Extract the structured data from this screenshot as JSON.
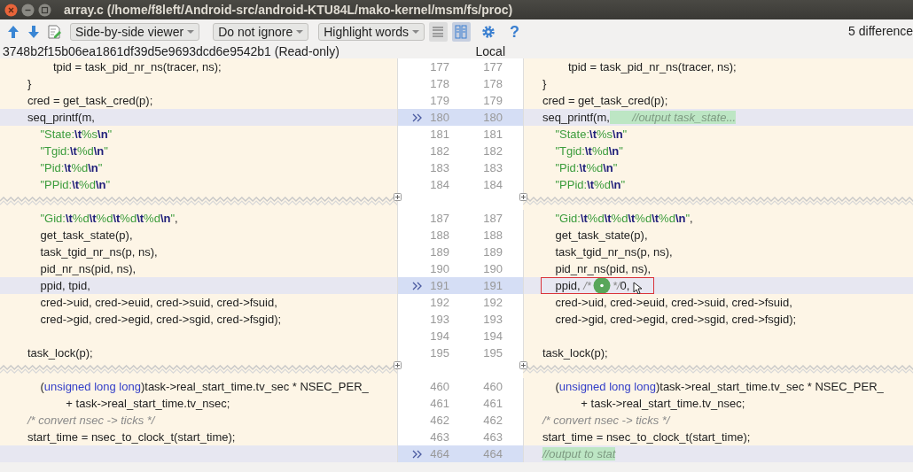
{
  "window": {
    "title": "array.c (/home/f8left/Android-src/android-KTU84L/mako-kernel/msm/fs/proc)"
  },
  "toolbar": {
    "viewer": "Side-by-side viewer",
    "ignore": "Do not ignore",
    "highlight": "Highlight words",
    "toggles": [
      {
        "selected": false
      },
      {
        "selected": true
      }
    ],
    "help": "?",
    "differences": "5 difference"
  },
  "header": {
    "left": "3748b2f15b06ea1861df39d5e9693dcd6e9542b1 (Read-only)",
    "right": "Local"
  },
  "hunks": [
    {
      "rows": [
        {
          "left_number": "177",
          "right_number": "177",
          "changed": false,
          "left": [
            {
              "text": "        tpid = task_pid_nr_ns(tracer, ns);",
              "kind": "code"
            }
          ],
          "right": [
            {
              "text": "        tpid = task_pid_nr_ns(tracer, ns);",
              "kind": "code"
            }
          ]
        },
        {
          "left_number": "178",
          "right_number": "178",
          "changed": false,
          "left": [
            {
              "text": "}",
              "kind": "code"
            }
          ],
          "right": [
            {
              "text": "}",
              "kind": "code"
            }
          ]
        },
        {
          "left_number": "179",
          "right_number": "179",
          "changed": false,
          "left": [
            {
              "text": "cred = get_task_cred(p);",
              "kind": "code"
            }
          ],
          "right": [
            {
              "text": "cred = get_task_cred(p);",
              "kind": "code"
            }
          ]
        },
        {
          "left_number": "180",
          "right_number": "180",
          "changed": true,
          "left": [
            {
              "text": "seq_printf(m,",
              "kind": "code"
            }
          ],
          "right": [
            {
              "text": "seq_printf(m,",
              "kind": "code"
            },
            {
              "text": "       //output task_state...",
              "kind": "added"
            }
          ]
        },
        {
          "left_number": "181",
          "right_number": "181",
          "changed": false,
          "left": [
            {
              "text": "    \"State:",
              "kind": "string"
            },
            {
              "text": "\\t",
              "kind": "escape"
            },
            {
              "text": "%s",
              "kind": "string"
            },
            {
              "text": "\\n",
              "kind": "escape"
            },
            {
              "text": "\"",
              "kind": "string"
            }
          ],
          "right": [
            {
              "text": "    \"State:",
              "kind": "string"
            },
            {
              "text": "\\t",
              "kind": "escape"
            },
            {
              "text": "%s",
              "kind": "string"
            },
            {
              "text": "\\n",
              "kind": "escape"
            },
            {
              "text": "\"",
              "kind": "string"
            }
          ]
        },
        {
          "left_number": "182",
          "right_number": "182",
          "changed": false,
          "left": [
            {
              "text": "    \"Tgid:",
              "kind": "string"
            },
            {
              "text": "\\t",
              "kind": "escape"
            },
            {
              "text": "%d",
              "kind": "string"
            },
            {
              "text": "\\n",
              "kind": "escape"
            },
            {
              "text": "\"",
              "kind": "string"
            }
          ],
          "right": [
            {
              "text": "    \"Tgid:",
              "kind": "string"
            },
            {
              "text": "\\t",
              "kind": "escape"
            },
            {
              "text": "%d",
              "kind": "string"
            },
            {
              "text": "\\n",
              "kind": "escape"
            },
            {
              "text": "\"",
              "kind": "string"
            }
          ]
        },
        {
          "left_number": "183",
          "right_number": "183",
          "changed": false,
          "left": [
            {
              "text": "    \"Pid:",
              "kind": "string"
            },
            {
              "text": "\\t",
              "kind": "escape"
            },
            {
              "text": "%d",
              "kind": "string"
            },
            {
              "text": "\\n",
              "kind": "escape"
            },
            {
              "text": "\"",
              "kind": "string"
            }
          ],
          "right": [
            {
              "text": "    \"Pid:",
              "kind": "string"
            },
            {
              "text": "\\t",
              "kind": "escape"
            },
            {
              "text": "%d",
              "kind": "string"
            },
            {
              "text": "\\n",
              "kind": "escape"
            },
            {
              "text": "\"",
              "kind": "string"
            }
          ]
        },
        {
          "left_number": "184",
          "right_number": "184",
          "changed": false,
          "left": [
            {
              "text": "    \"PPid:",
              "kind": "string"
            },
            {
              "text": "\\t",
              "kind": "escape"
            },
            {
              "text": "%d",
              "kind": "string"
            },
            {
              "text": "\\n",
              "kind": "escape"
            },
            {
              "text": "\"",
              "kind": "string"
            }
          ],
          "right": [
            {
              "text": "    \"PPid:",
              "kind": "string"
            },
            {
              "text": "\\t",
              "kind": "escape"
            },
            {
              "text": "%d",
              "kind": "string"
            },
            {
              "text": "\\n",
              "kind": "escape"
            },
            {
              "text": "\"",
              "kind": "string"
            }
          ]
        }
      ]
    },
    {
      "rows": [
        {
          "left_number": "187",
          "right_number": "187",
          "changed": false,
          "left": [
            {
              "text": "    \"Gid:",
              "kind": "string"
            },
            {
              "text": "\\t",
              "kind": "escape"
            },
            {
              "text": "%d",
              "kind": "string"
            },
            {
              "text": "\\t",
              "kind": "escape"
            },
            {
              "text": "%d",
              "kind": "string"
            },
            {
              "text": "\\t",
              "kind": "escape"
            },
            {
              "text": "%d",
              "kind": "string"
            },
            {
              "text": "\\t",
              "kind": "escape"
            },
            {
              "text": "%d",
              "kind": "string"
            },
            {
              "text": "\\n",
              "kind": "escape"
            },
            {
              "text": "\"",
              "kind": "string"
            },
            {
              "text": ",",
              "kind": "code"
            }
          ],
          "right": [
            {
              "text": "    \"Gid:",
              "kind": "string"
            },
            {
              "text": "\\t",
              "kind": "escape"
            },
            {
              "text": "%d",
              "kind": "string"
            },
            {
              "text": "\\t",
              "kind": "escape"
            },
            {
              "text": "%d",
              "kind": "string"
            },
            {
              "text": "\\t",
              "kind": "escape"
            },
            {
              "text": "%d",
              "kind": "string"
            },
            {
              "text": "\\t",
              "kind": "escape"
            },
            {
              "text": "%d",
              "kind": "string"
            },
            {
              "text": "\\n",
              "kind": "escape"
            },
            {
              "text": "\"",
              "kind": "string"
            },
            {
              "text": ",",
              "kind": "code"
            }
          ]
        },
        {
          "left_number": "188",
          "right_number": "188",
          "changed": false,
          "left": [
            {
              "text": "    get_task_state(p),",
              "kind": "code"
            }
          ],
          "right": [
            {
              "text": "    get_task_state(p),",
              "kind": "code"
            }
          ]
        },
        {
          "left_number": "189",
          "right_number": "189",
          "changed": false,
          "left": [
            {
              "text": "    task_tgid_nr_ns(p, ns),",
              "kind": "code"
            }
          ],
          "right": [
            {
              "text": "    task_tgid_nr_ns(p, ns),",
              "kind": "code"
            }
          ]
        },
        {
          "left_number": "190",
          "right_number": "190",
          "changed": false,
          "left": [
            {
              "text": "    pid_nr_ns(pid, ns),",
              "kind": "code"
            }
          ],
          "right": [
            {
              "text": "    pid_nr_ns(pid, ns),",
              "kind": "code"
            }
          ]
        },
        {
          "left_number": "191",
          "right_number": "191",
          "changed": true,
          "right_annotated": true,
          "left": [
            {
              "text": "    ppid, tpid,",
              "kind": "code"
            }
          ],
          "right": [
            {
              "text": "    ppid, ",
              "kind": "code"
            },
            {
              "text": "/*",
              "kind": "comment"
            },
            {
              "kind": "click"
            },
            {
              "text": "*/",
              "kind": "comment"
            },
            {
              "text": "0,",
              "kind": "code"
            }
          ]
        },
        {
          "left_number": "192",
          "right_number": "192",
          "changed": false,
          "left": [
            {
              "text": "    cred->uid, cred->euid, cred->suid, cred->fsuid,",
              "kind": "code"
            }
          ],
          "right": [
            {
              "text": "    cred->uid, cred->euid, cred->suid, cred->fsuid,",
              "kind": "code"
            }
          ]
        },
        {
          "left_number": "193",
          "right_number": "193",
          "changed": false,
          "left": [
            {
              "text": "    cred->gid, cred->egid, cred->sgid, cred->fsgid);",
              "kind": "code"
            }
          ],
          "right": [
            {
              "text": "    cred->gid, cred->egid, cred->sgid, cred->fsgid);",
              "kind": "code"
            }
          ]
        },
        {
          "left_number": "194",
          "right_number": "194",
          "changed": false
        },
        {
          "left_number": "195",
          "right_number": "195",
          "changed": false,
          "left": [
            {
              "text": "task_lock(p);",
              "kind": "code"
            }
          ],
          "right": [
            {
              "text": "task_lock(p);",
              "kind": "code"
            }
          ]
        }
      ]
    },
    {
      "rows": [
        {
          "left_number": "460",
          "right_number": "460",
          "changed": false,
          "left": [
            {
              "text": "    (",
              "kind": "code"
            },
            {
              "text": "unsigned long long",
              "kind": "keyword"
            },
            {
              "text": ")task->real_start_time.tv_sec * NSEC_PER_",
              "kind": "code"
            }
          ],
          "right": [
            {
              "text": "    (",
              "kind": "code"
            },
            {
              "text": "unsigned long long",
              "kind": "keyword"
            },
            {
              "text": ")task->real_start_time.tv_sec * NSEC_PER_",
              "kind": "code"
            }
          ]
        },
        {
          "left_number": "461",
          "right_number": "461",
          "changed": false,
          "left": [
            {
              "text": "            + task->real_start_time.tv_nsec;",
              "kind": "code"
            }
          ],
          "right": [
            {
              "text": "            + task->real_start_time.tv_nsec;",
              "kind": "code"
            }
          ]
        },
        {
          "left_number": "462",
          "right_number": "462",
          "changed": false,
          "left": [
            {
              "text": "/* convert nsec -> ticks */",
              "kind": "comment"
            }
          ],
          "right": [
            {
              "text": "/* convert nsec -> ticks */",
              "kind": "comment"
            }
          ]
        },
        {
          "left_number": "463",
          "right_number": "463",
          "changed": false,
          "left": [
            {
              "text": "start_time = nsec_to_clock_t(start_time);",
              "kind": "code"
            }
          ],
          "right": [
            {
              "text": "start_time = nsec_to_clock_t(start_time);",
              "kind": "code"
            }
          ]
        },
        {
          "left_number": "464",
          "right_number": "464",
          "changed": true,
          "right": [
            {
              "text": "//output to stat",
              "kind": "added"
            }
          ]
        }
      ]
    }
  ]
}
